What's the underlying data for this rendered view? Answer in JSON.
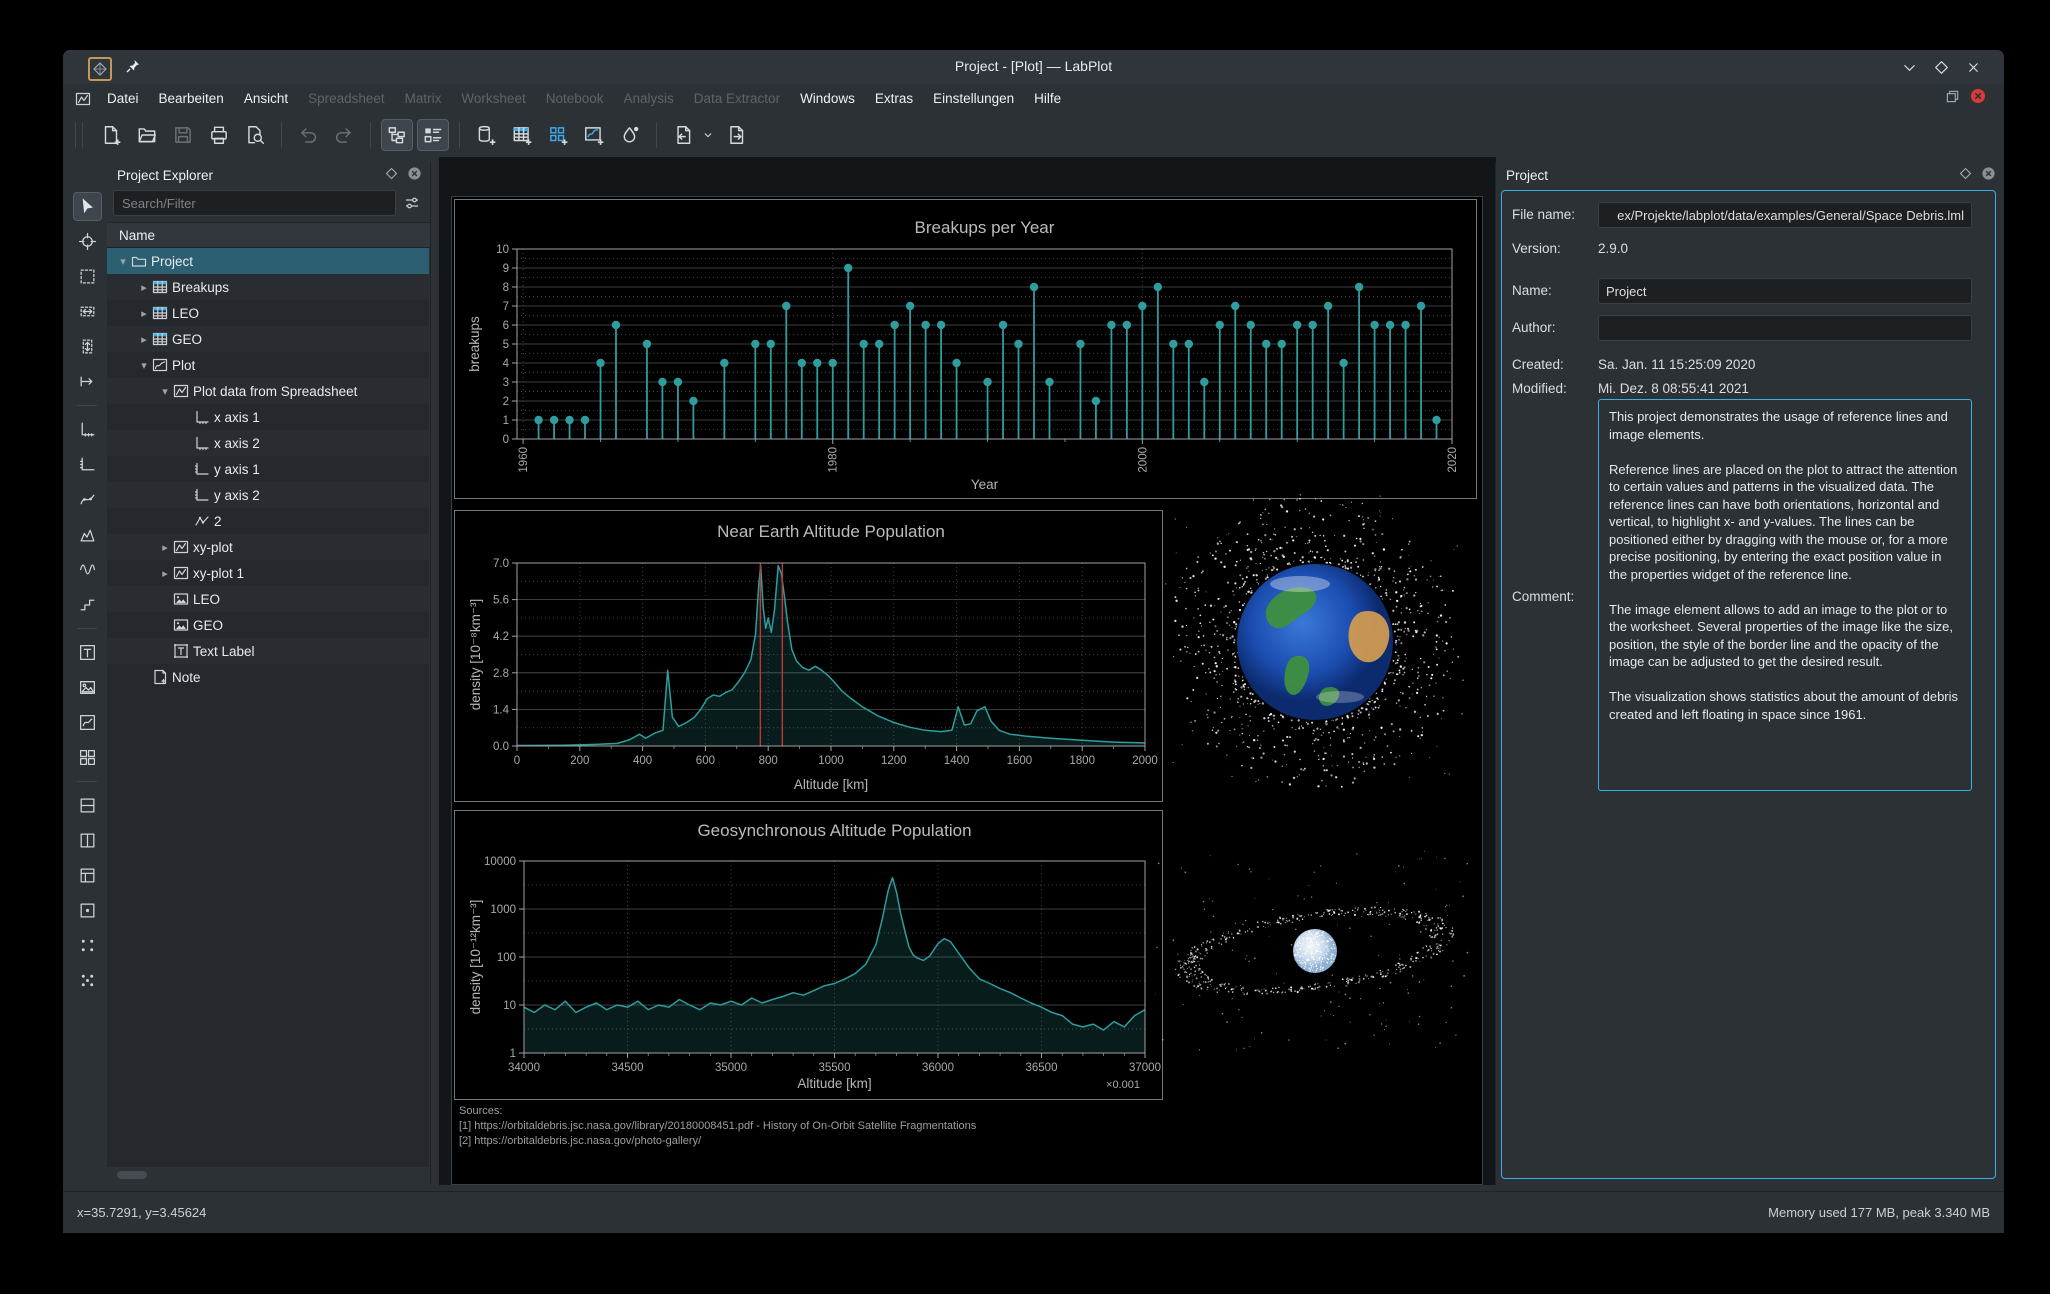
{
  "window": {
    "title": "Project - [Plot] — LabPlot",
    "statusbar_left": "x=35.7291, y=3.45624",
    "statusbar_right": "Memory used 177 MB, peak 3.340 MB"
  },
  "titlebar": {
    "app_icon": "labplot-logo-icon",
    "pin_icon": "pin-icon",
    "buttons": [
      {
        "name": "shade-window-button",
        "icon": "chevron-down-icon"
      },
      {
        "name": "maximize-window-button",
        "icon": "diamond-icon"
      },
      {
        "name": "close-window-button",
        "icon": "close-icon"
      }
    ]
  },
  "menubar": {
    "items": [
      {
        "label": "Datei",
        "enabled": true
      },
      {
        "label": "Bearbeiten",
        "enabled": true
      },
      {
        "label": "Ansicht",
        "enabled": true
      },
      {
        "label": "Spreadsheet",
        "enabled": false
      },
      {
        "label": "Matrix",
        "enabled": false
      },
      {
        "label": "Worksheet",
        "enabled": false
      },
      {
        "label": "Notebook",
        "enabled": false
      },
      {
        "label": "Analysis",
        "enabled": false
      },
      {
        "label": "Data Extractor",
        "enabled": false
      },
      {
        "label": "Windows",
        "enabled": true
      },
      {
        "label": "Extras",
        "enabled": true
      },
      {
        "label": "Einstellungen",
        "enabled": true
      },
      {
        "label": "Hilfe",
        "enabled": true
      }
    ],
    "corner_icons": [
      "mdi-restore-icon",
      "mdi-close-icon"
    ]
  },
  "toolbar": {
    "buttons": [
      {
        "name": "document-new"
      },
      {
        "name": "document-open"
      },
      {
        "name": "document-save",
        "enabled": false
      },
      {
        "name": "document-print"
      },
      {
        "name": "print-preview"
      },
      {
        "name": "separator"
      },
      {
        "name": "edit-undo",
        "enabled": false
      },
      {
        "name": "edit-redo",
        "enabled": false
      },
      {
        "name": "separator"
      },
      {
        "name": "toggle-project-explorer",
        "pressed": true
      },
      {
        "name": "toggle-properties-explorer",
        "pressed": true
      },
      {
        "name": "separator"
      },
      {
        "name": "new-workbook"
      },
      {
        "name": "new-spreadsheet"
      },
      {
        "name": "new-matrix"
      },
      {
        "name": "new-worksheet"
      },
      {
        "name": "color-theme"
      },
      {
        "name": "separator"
      },
      {
        "name": "import-data",
        "dropdown": true
      },
      {
        "name": "export"
      }
    ]
  },
  "tool_column": {
    "tools": [
      {
        "name": "pointer-tool",
        "active": true
      },
      {
        "name": "crosshair-tool"
      },
      {
        "name": "zoom-select-tool"
      },
      {
        "name": "zoom-x-select-tool"
      },
      {
        "name": "zoom-y-select-tool"
      },
      {
        "name": "shift-view-tool"
      },
      {
        "name": "separator"
      },
      {
        "name": "add-x-axis-tool"
      },
      {
        "name": "add-y-axis-tool"
      },
      {
        "name": "add-xy-curve-tool"
      },
      {
        "name": "add-histogram-tool"
      },
      {
        "name": "add-fourier-curve-tool"
      },
      {
        "name": "add-step-curve-tool"
      },
      {
        "name": "separator"
      },
      {
        "name": "add-text-label-tool"
      },
      {
        "name": "add-image-tool"
      },
      {
        "name": "add-plot-area-tool"
      },
      {
        "name": "add-four-plots-tool"
      },
      {
        "name": "separator"
      },
      {
        "name": "layout-box-1-tool"
      },
      {
        "name": "layout-box-2-tool"
      },
      {
        "name": "layout-box-3-tool"
      },
      {
        "name": "layout-box-4-tool"
      },
      {
        "name": "snap-points-tool"
      },
      {
        "name": "more-points-tool"
      }
    ]
  },
  "project_explorer": {
    "title": "Project Explorer",
    "header_icons": [
      "float-dock-icon",
      "close-dock-icon"
    ],
    "search_placeholder": "Search/Filter",
    "filter_icon": "filter-options-icon",
    "column_header": "Name",
    "tree": [
      {
        "label": "Project",
        "depth": 0,
        "icon": "folder",
        "expander": "open",
        "selected": true
      },
      {
        "label": "Breakups",
        "depth": 1,
        "icon": "spreadsheet",
        "expander": "closed"
      },
      {
        "label": "LEO",
        "depth": 1,
        "icon": "spreadsheet",
        "expander": "closed"
      },
      {
        "label": "GEO",
        "depth": 1,
        "icon": "spreadsheet",
        "expander": "closed"
      },
      {
        "label": "Plot",
        "depth": 1,
        "icon": "worksheet",
        "expander": "open"
      },
      {
        "label": "Plot data from Spreadsheet",
        "depth": 2,
        "icon": "xy-plot",
        "expander": "open"
      },
      {
        "label": "x axis 1",
        "depth": 3,
        "icon": "axis-x"
      },
      {
        "label": "x axis 2",
        "depth": 3,
        "icon": "axis-x"
      },
      {
        "label": "y axis 1",
        "depth": 3,
        "icon": "axis-y"
      },
      {
        "label": "y axis 2",
        "depth": 3,
        "icon": "axis-y"
      },
      {
        "label": "2",
        "depth": 3,
        "icon": "xy-curve"
      },
      {
        "label": "xy-plot",
        "depth": 2,
        "icon": "xy-plot",
        "expander": "closed"
      },
      {
        "label": "xy-plot 1",
        "depth": 2,
        "icon": "xy-plot",
        "expander": "closed"
      },
      {
        "label": "LEO",
        "depth": 2,
        "icon": "image"
      },
      {
        "label": "GEO",
        "depth": 2,
        "icon": "image"
      },
      {
        "label": "Text Label",
        "depth": 2,
        "icon": "text-label"
      },
      {
        "label": "Note",
        "depth": 1,
        "icon": "note"
      }
    ]
  },
  "worksheet": {
    "sources": [
      "Sources:",
      "[1] https://orbitaldebris.jsc.nasa.gov/library/20180008451.pdf  - History of On-Orbit Satellite Fragmentations",
      "[2] https://orbitaldebris.jsc.nasa.gov/photo-gallery/"
    ],
    "images": [
      "earth-with-debris-cloud",
      "earth-with-debris-ring"
    ]
  },
  "properties": {
    "title": "Project",
    "header_icons": [
      "float-dock-icon",
      "close-dock-icon"
    ],
    "file_name_label": "File name:",
    "file_name": "ex/Projekte/labplot/data/examples/General/Space Debris.lml",
    "version_label": "Version:",
    "version": "2.9.0",
    "name_label": "Name:",
    "name": "Project",
    "author_label": "Author:",
    "author": "",
    "created_label": "Created:",
    "created": "Sa. Jan. 11 15:25:09 2020",
    "modified_label": "Modified:",
    "modified": "Mi. Dez. 8 08:55:41 2021",
    "comment_label": "Comment:",
    "comment": "This project demonstrates the usage of reference lines and image elements.\n\nReference lines are placed on the plot to attract the attention to certain values and patterns in the visualized data. The reference lines can have both orientations, horizontal and vertical, to highlight x- and y-values. The lines can be positioned either by dragging with the mouse or, for a more precise positioning, by entering the exact position value in the properties widget of the reference line.\n\nThe image element allows to add an image to the plot or to the worksheet. Several properties of the image like the size, position, the style of the border line and the opacity of the image can be adjusted to get the desired result.\n\nThe visualization shows statistics about the amount of debris created and left floating in space since 1961."
  },
  "chart_data": [
    {
      "type": "stem",
      "title": "Breakups per Year",
      "xlabel": "Year",
      "ylabel": "breakups",
      "xlim": [
        1959.8,
        2020
      ],
      "ylim": [
        0,
        10
      ],
      "xticks": [
        1960,
        1980,
        2000,
        2020
      ],
      "ytick_step": 1,
      "color": "#2f9d9d",
      "points": [
        [
          1961,
          1
        ],
        [
          1962,
          1
        ],
        [
          1963,
          1
        ],
        [
          1964,
          1
        ],
        [
          1965,
          4
        ],
        [
          1966,
          6
        ],
        [
          1968,
          5
        ],
        [
          1969,
          3
        ],
        [
          1970,
          3
        ],
        [
          1971,
          2
        ],
        [
          1973,
          4
        ],
        [
          1975,
          5
        ],
        [
          1976,
          5
        ],
        [
          1977,
          7
        ],
        [
          1978,
          4
        ],
        [
          1979,
          4
        ],
        [
          1980,
          4
        ],
        [
          1981,
          9
        ],
        [
          1982,
          5
        ],
        [
          1983,
          5
        ],
        [
          1984,
          6
        ],
        [
          1985,
          7
        ],
        [
          1986,
          6
        ],
        [
          1987,
          6
        ],
        [
          1988,
          4
        ],
        [
          1990,
          3
        ],
        [
          1991,
          6
        ],
        [
          1992,
          5
        ],
        [
          1993,
          8
        ],
        [
          1994,
          3
        ],
        [
          1996,
          5
        ],
        [
          1997,
          2
        ],
        [
          1998,
          6
        ],
        [
          1999,
          6
        ],
        [
          2000,
          7
        ],
        [
          2001,
          8
        ],
        [
          2002,
          5
        ],
        [
          2003,
          5
        ],
        [
          2004,
          3
        ],
        [
          2005,
          6
        ],
        [
          2006,
          7
        ],
        [
          2007,
          6
        ],
        [
          2008,
          5
        ],
        [
          2009,
          5
        ],
        [
          2010,
          6
        ],
        [
          2011,
          6
        ],
        [
          2012,
          7
        ],
        [
          2013,
          4
        ],
        [
          2014,
          8
        ],
        [
          2015,
          6
        ],
        [
          2016,
          6
        ],
        [
          2017,
          6
        ],
        [
          2018,
          7
        ],
        [
          2019,
          1
        ]
      ]
    },
    {
      "type": "line",
      "title": "Near Earth Altitude Population",
      "xlabel": "Altitude [km]",
      "ylabel": "density [10⁻⁸km⁻³]",
      "xlim": [
        0,
        2000
      ],
      "ylim": [
        0,
        7
      ],
      "xtick_step": 200,
      "yticks": [
        0,
        1.4,
        2.8,
        4.2,
        5.6,
        7
      ],
      "reference_lines_x": [
        775,
        845
      ],
      "reference_color": "#c33434",
      "color": "#2f9d9d",
      "points": [
        [
          0,
          0.02
        ],
        [
          150,
          0.03
        ],
        [
          250,
          0.06
        ],
        [
          320,
          0.1
        ],
        [
          360,
          0.25
        ],
        [
          390,
          0.45
        ],
        [
          410,
          0.3
        ],
        [
          440,
          0.5
        ],
        [
          465,
          0.6
        ],
        [
          480,
          2.9
        ],
        [
          495,
          1.1
        ],
        [
          515,
          0.75
        ],
        [
          540,
          0.9
        ],
        [
          565,
          1.1
        ],
        [
          585,
          1.4
        ],
        [
          605,
          1.8
        ],
        [
          625,
          1.95
        ],
        [
          645,
          1.9
        ],
        [
          665,
          2.05
        ],
        [
          685,
          2.15
        ],
        [
          705,
          2.45
        ],
        [
          725,
          2.8
        ],
        [
          745,
          3.3
        ],
        [
          760,
          4.3
        ],
        [
          770,
          6.2
        ],
        [
          776,
          6.9
        ],
        [
          784,
          5.3
        ],
        [
          792,
          4.5
        ],
        [
          800,
          4.9
        ],
        [
          810,
          4.35
        ],
        [
          820,
          5.2
        ],
        [
          832,
          6.9
        ],
        [
          842,
          6.6
        ],
        [
          852,
          5.7
        ],
        [
          862,
          4.7
        ],
        [
          875,
          3.7
        ],
        [
          890,
          3.25
        ],
        [
          910,
          3.0
        ],
        [
          930,
          2.9
        ],
        [
          950,
          3.05
        ],
        [
          970,
          2.9
        ],
        [
          990,
          2.7
        ],
        [
          1010,
          2.45
        ],
        [
          1035,
          2.1
        ],
        [
          1060,
          1.85
        ],
        [
          1100,
          1.5
        ],
        [
          1150,
          1.15
        ],
        [
          1200,
          0.9
        ],
        [
          1250,
          0.72
        ],
        [
          1300,
          0.6
        ],
        [
          1350,
          0.55
        ],
        [
          1385,
          0.6
        ],
        [
          1405,
          1.5
        ],
        [
          1425,
          0.8
        ],
        [
          1445,
          0.85
        ],
        [
          1465,
          1.35
        ],
        [
          1490,
          1.5
        ],
        [
          1510,
          0.95
        ],
        [
          1535,
          0.6
        ],
        [
          1570,
          0.45
        ],
        [
          1620,
          0.38
        ],
        [
          1700,
          0.3
        ],
        [
          1800,
          0.22
        ],
        [
          1900,
          0.15
        ],
        [
          2000,
          0.12
        ]
      ]
    },
    {
      "type": "line-log",
      "title": "Geosynchronous Altitude Population",
      "xlabel": "Altitude [km]",
      "ylabel": "density [10⁻¹²km⁻³]",
      "x_scale_note": "×0.001",
      "xlim": [
        34000,
        37000
      ],
      "ylim_log": [
        1,
        10000
      ],
      "xtick_step": 500,
      "yticks": [
        1,
        10,
        100,
        1000,
        10000
      ],
      "color": "#2f9d9d",
      "points": [
        [
          34000,
          9
        ],
        [
          34050,
          7
        ],
        [
          34100,
          10
        ],
        [
          34150,
          8
        ],
        [
          34200,
          12
        ],
        [
          34250,
          7
        ],
        [
          34300,
          9
        ],
        [
          34350,
          11
        ],
        [
          34400,
          8
        ],
        [
          34450,
          10
        ],
        [
          34500,
          9
        ],
        [
          34550,
          12
        ],
        [
          34600,
          8
        ],
        [
          34650,
          10
        ],
        [
          34700,
          9
        ],
        [
          34750,
          13
        ],
        [
          34800,
          10
        ],
        [
          34850,
          8
        ],
        [
          34900,
          11
        ],
        [
          34950,
          10
        ],
        [
          35000,
          12
        ],
        [
          35050,
          10
        ],
        [
          35100,
          14
        ],
        [
          35150,
          11
        ],
        [
          35200,
          13
        ],
        [
          35250,
          15
        ],
        [
          35300,
          18
        ],
        [
          35350,
          16
        ],
        [
          35400,
          20
        ],
        [
          35450,
          25
        ],
        [
          35500,
          28
        ],
        [
          35550,
          35
        ],
        [
          35600,
          45
        ],
        [
          35650,
          70
        ],
        [
          35700,
          180
        ],
        [
          35730,
          600
        ],
        [
          35760,
          2500
        ],
        [
          35780,
          4500
        ],
        [
          35800,
          2200
        ],
        [
          35820,
          800
        ],
        [
          35840,
          350
        ],
        [
          35860,
          160
        ],
        [
          35880,
          110
        ],
        [
          35900,
          95
        ],
        [
          35930,
          85
        ],
        [
          35960,
          105
        ],
        [
          36000,
          190
        ],
        [
          36030,
          240
        ],
        [
          36060,
          210
        ],
        [
          36100,
          120
        ],
        [
          36150,
          60
        ],
        [
          36200,
          35
        ],
        [
          36250,
          28
        ],
        [
          36300,
          22
        ],
        [
          36350,
          18
        ],
        [
          36400,
          14
        ],
        [
          36450,
          11
        ],
        [
          36500,
          9
        ],
        [
          36550,
          7
        ],
        [
          36600,
          6
        ],
        [
          36650,
          4
        ],
        [
          36700,
          3.5
        ],
        [
          36750,
          4
        ],
        [
          36800,
          3
        ],
        [
          36850,
          4.5
        ],
        [
          36900,
          3.5
        ],
        [
          36950,
          6
        ],
        [
          37000,
          8
        ]
      ]
    }
  ]
}
